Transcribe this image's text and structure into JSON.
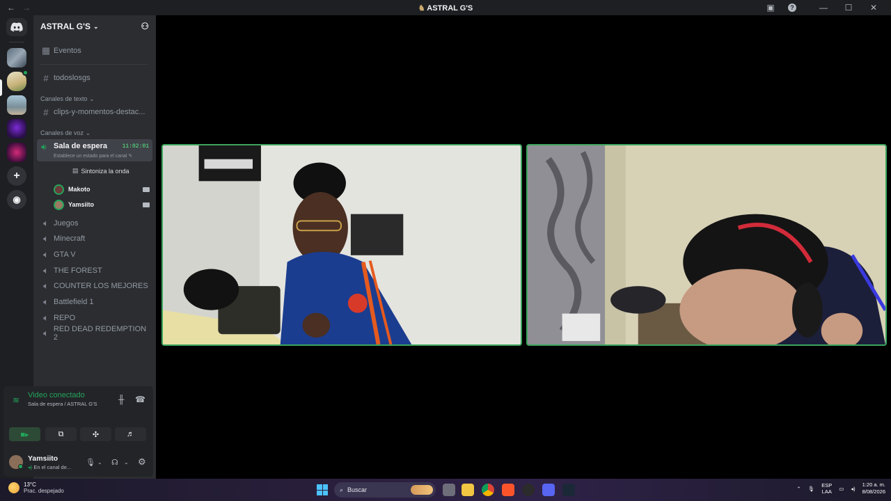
{
  "titlebar": {
    "title": "ASTRAL G'S",
    "back": "←",
    "forward": "→",
    "minimize": "—",
    "maximize": "☐",
    "close": "✕",
    "help": "?"
  },
  "server": {
    "name": "ASTRAL G'S"
  },
  "channels": {
    "events": "Eventos",
    "todos": "todoslosgs",
    "text_category": "Canales de texto",
    "clips": "clips-y-momentos-destac...",
    "voice_category": "Canales de voz",
    "active_voice": {
      "name": "Sala de espera",
      "timer": "11:02:01",
      "status": "Establece un estado para el canal"
    },
    "activity_label": "Sintoniza la onda",
    "members": [
      "Makoto",
      "Yamsiito"
    ],
    "voice_list": [
      "Juegos",
      "Minecraft",
      "GTA V",
      "THE FOREST",
      "COUNTER LOS MEJORES",
      "Battlefield 1",
      "REPO",
      "RED DEAD REDEMPTION 2"
    ]
  },
  "voice_panel": {
    "connected": "Video conectado",
    "location": "Sala de espera / ASTRAL G'S"
  },
  "user": {
    "name": "Yamsiito",
    "status": "En el canal de..."
  },
  "taskbar": {
    "temp": "13°C",
    "weather": "Prac. despejado",
    "search": "Buscar",
    "lang_top": "ESP",
    "lang_bottom": "LAA",
    "time": "1:20 a. m.",
    "date": "8/08/2026"
  },
  "colors": {
    "accent_green": "#23a55a",
    "video_border": "#3ba55d",
    "sidebar": "#2b2d31",
    "rail": "#1e1f22"
  }
}
